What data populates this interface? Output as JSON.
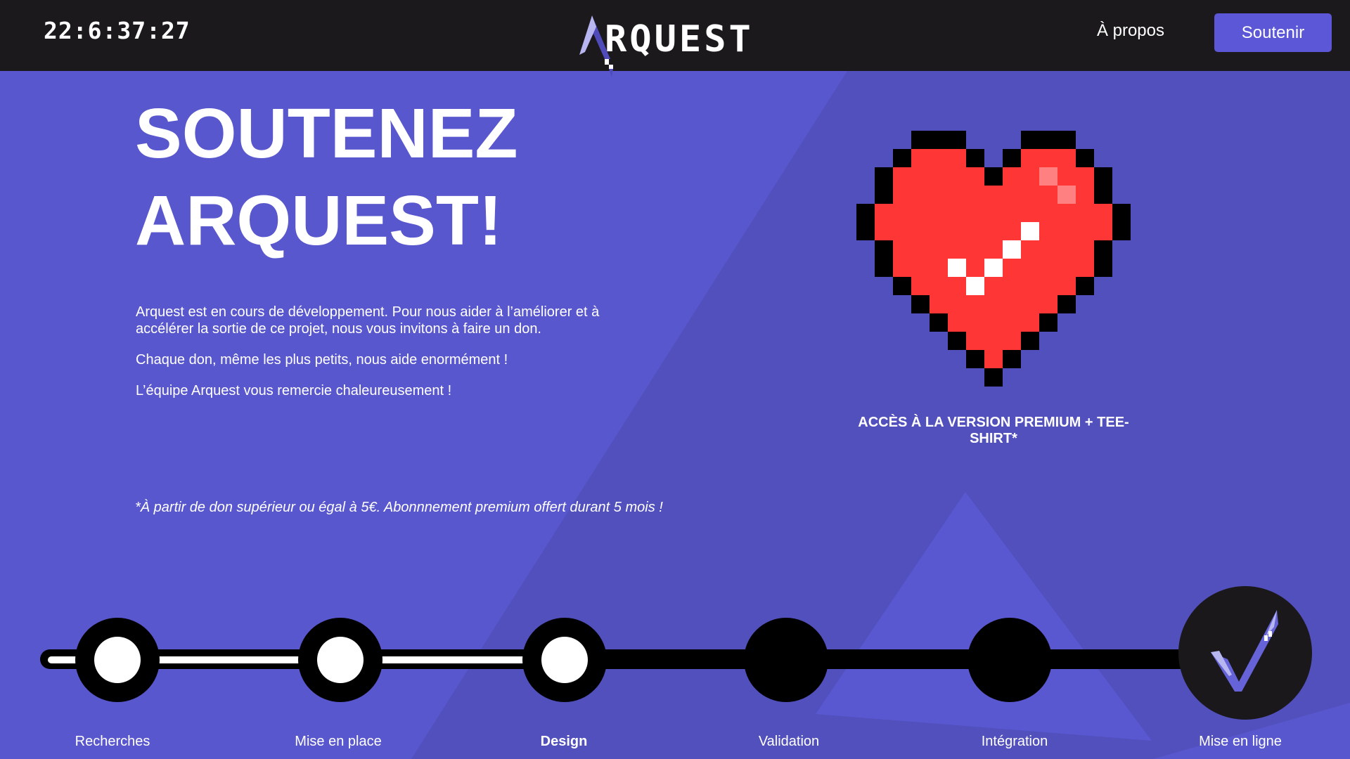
{
  "header": {
    "timer": "22:6:37:27",
    "logo_text": "RQUEST",
    "nav": {
      "about": "À propos"
    },
    "cta": "Soutenir"
  },
  "hero": {
    "title_line1": "SOUTENEZ",
    "title_line2": "ARQUEST!",
    "paragraphs": [
      "Arquest est en cours de développement. Pour nous aider à l’améliorer et à accélérer la sortie de ce projet, nous vous invitons à faire un don.",
      "Chaque don, même les plus petits, nous aide enormément !",
      "L’équipe Arquest vous remercie chaleureusement !"
    ],
    "footnote": "*À partir de don supérieur ou égal à 5€. Abonnnement premium offert durant 5 mois !"
  },
  "reward": {
    "label": "ACCÈS À LA VERSION PREMIUM + TEE-SHIRT*",
    "icon": "pixel-heart-check-icon"
  },
  "timeline": {
    "steps": [
      {
        "label": "Recherches",
        "done": true
      },
      {
        "label": "Mise en place",
        "done": true
      },
      {
        "label": "Design",
        "done": true,
        "current": true
      },
      {
        "label": "Validation",
        "done": false
      },
      {
        "label": "Intégration",
        "done": false
      },
      {
        "label": "Mise en ligne",
        "done": false,
        "icon": "check-icon"
      }
    ]
  },
  "colors": {
    "background": "#5957cd",
    "header": "#1b191b",
    "accent": "#5b57d6",
    "heart": "#ff3636"
  }
}
